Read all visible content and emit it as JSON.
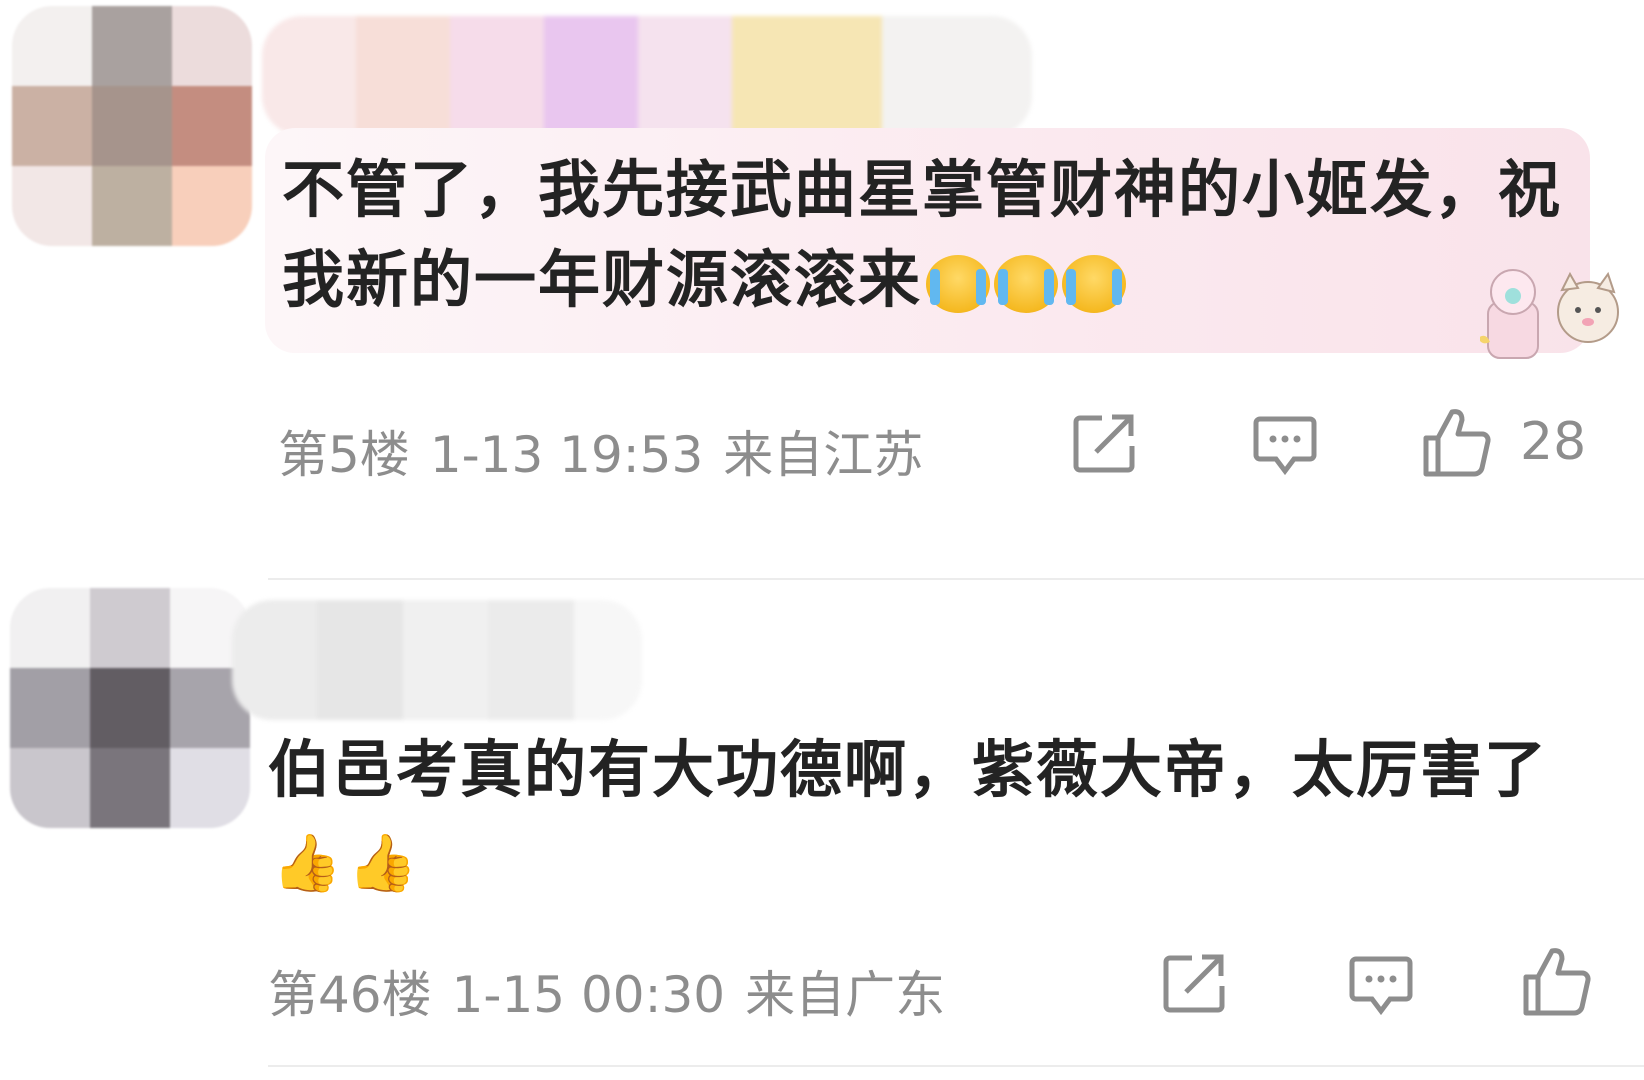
{
  "comments": [
    {
      "text": "不管了，我先接武曲星掌管财神的小姬发，祝我新的一年财源滚滚来",
      "emoji_count": 3,
      "emoji_icon": "crying-laughing-emoji-icon",
      "floor": "第5楼",
      "time": "1-13 19:53",
      "location": "来自江苏",
      "likes": "28",
      "highlighted": true
    },
    {
      "text": "伯邑考真的有大功德啊，紫薇大帝，太厉害了",
      "emoji_count": 2,
      "emoji_icon": "thumbs-up-emoji-icon",
      "floor": "第46楼",
      "time": "1-15 00:30",
      "location": "来自广东",
      "likes": "",
      "highlighted": false
    }
  ],
  "icons": {
    "share": "share-icon",
    "reply": "comment-bubble-icon",
    "like": "thumbs-up-icon"
  },
  "colors": {
    "text": "#232323",
    "meta": "#8d8d8d",
    "bubble": "#fbe9ef"
  }
}
